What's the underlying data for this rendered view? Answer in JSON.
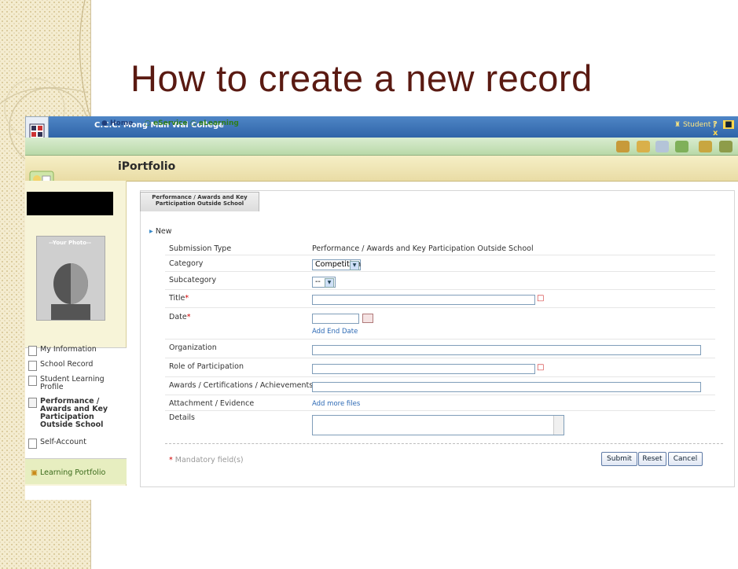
{
  "slide": {
    "title": "How to create a new record"
  },
  "header": {
    "school_name": "C.C.C. Mong Man Wai College",
    "student_label": "Student",
    "help_label": "?"
  },
  "nav": {
    "home": "Home",
    "eservice": "eService",
    "elearning": "eLearning"
  },
  "module": {
    "title": "iPortfolio"
  },
  "profile": {
    "photo_placeholder": "--Your Photo--"
  },
  "menu": {
    "items": [
      "My Information",
      "School Record",
      "Student Learning Profile",
      "Performance / Awards and Key Participation Outside School",
      "Self-Account"
    ],
    "learning_portfolio": "Learning Portfolio"
  },
  "tab": {
    "label": "Performance / Awards and Key Participation Outside School"
  },
  "form": {
    "section": "New",
    "submission_type_label": "Submission Type",
    "submission_type_value": "Performance / Awards and Key Participation Outside School",
    "category_label": "Category",
    "category_value": "Competition",
    "subcategory_label": "Subcategory",
    "subcategory_value": "--",
    "title_label": "Title",
    "date_label": "Date",
    "add_end_date": "Add End Date",
    "organization_label": "Organization",
    "role_label": "Role of Participation",
    "awards_label": "Awards / Certifications / Achievements",
    "attachment_label": "Attachment / Evidence",
    "add_more_files": "Add more files",
    "details_label": "Details",
    "mandatory_note": "Mandatory field(s)",
    "required_mark": "*"
  },
  "buttons": {
    "submit": "Submit",
    "reset": "Reset",
    "cancel": "Cancel"
  },
  "colors": {
    "title": "#5a1a12",
    "topbar": "#2f64a8",
    "required": "#d10000",
    "link": "#2d6ab5"
  }
}
